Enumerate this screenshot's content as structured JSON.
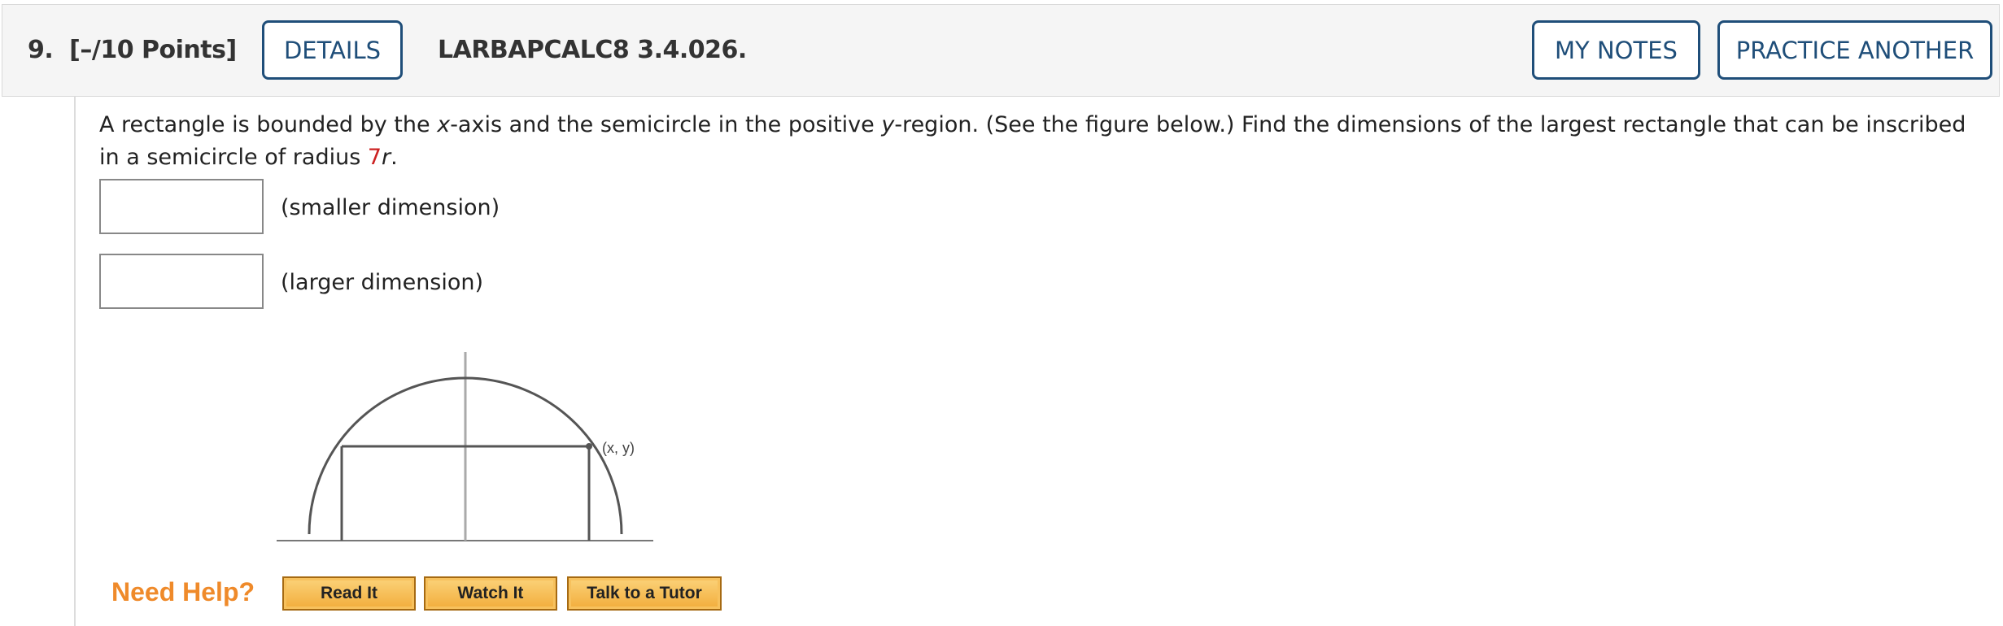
{
  "header": {
    "question_number": "9.",
    "points": "[–/10 Points]",
    "details_label": "DETAILS",
    "problem_code": "LARBAPCALC8 3.4.026.",
    "my_notes_label": "MY NOTES",
    "practice_label": "PRACTICE ANOTHER"
  },
  "question": {
    "part1": "A rectangle is bounded by the ",
    "x_var": "x",
    "part2": "-axis and the semicircle in the positive ",
    "y_var": "y",
    "part3": "-region. (See the figure below.) Find the dimensions of the largest rectangle that can be inscribed in a semicircle of radius ",
    "radius_value": "7",
    "r_var": "r",
    "part4": "."
  },
  "answers": [
    {
      "value": "",
      "label": "(smaller dimension)"
    },
    {
      "value": "",
      "label": "(larger dimension)"
    }
  ],
  "figure": {
    "point_label": "(x, y)"
  },
  "help": {
    "need_help": "Need Help?",
    "read_it": "Read It",
    "watch_it": "Watch It",
    "talk_tutor": "Talk to a Tutor"
  },
  "colors": {
    "accent_blue": "#1f4e79",
    "highlight_red": "#cc2222",
    "need_help_orange": "#ef8a2a"
  }
}
